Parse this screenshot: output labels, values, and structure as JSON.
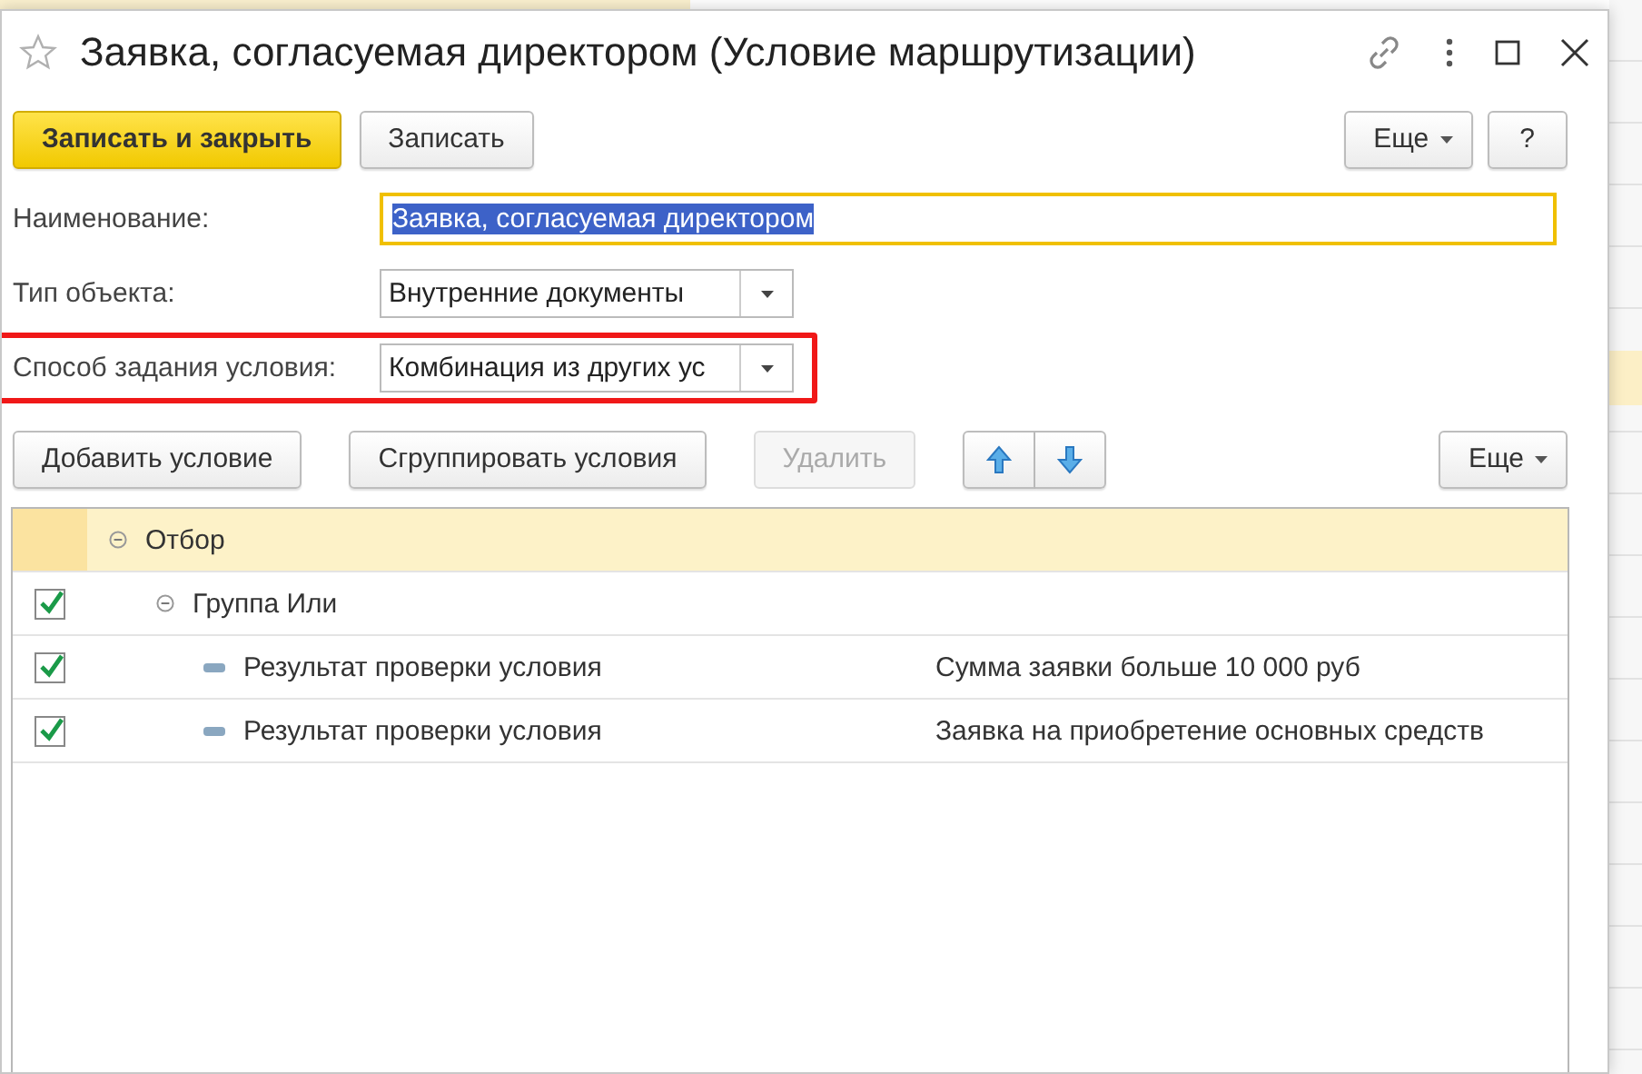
{
  "window": {
    "title": "Заявка, согласуемая директором (Условие маршрутизации)",
    "favorite": false
  },
  "toolbar": {
    "buttons": [
      {
        "label": "Записать и закрыть",
        "kind": "primary"
      },
      {
        "label": "Записать",
        "kind": "normal"
      }
    ],
    "more": "Еще",
    "help": "?"
  },
  "fields": [
    {
      "label": "Наименование:",
      "value": "Заявка, согласуемая директором",
      "kind": "text",
      "focused": true,
      "selected": true
    },
    {
      "label": "Тип объекта:",
      "value": "Внутренние документы",
      "kind": "select",
      "highlighted": false
    },
    {
      "label": "Способ задания условия:",
      "value": "Комбинация из других ус",
      "kind": "select",
      "highlighted": true
    }
  ],
  "conditions_toolbar": {
    "buttons": [
      {
        "label": "Добавить условие",
        "disabled": false
      },
      {
        "label": "Сгруппировать условия",
        "disabled": false
      },
      {
        "label": "Удалить",
        "disabled": true
      }
    ],
    "more": "Еще"
  },
  "tree": [
    {
      "label": "Отбор",
      "expanded": true,
      "selected": true,
      "children": [
        {
          "label": "Группа Или",
          "checked": true,
          "expanded": true,
          "selected": false,
          "children": [
            {
              "label": "Результат проверки условия",
              "value": "Сумма заявки больше 10 000 руб",
              "checked": true,
              "selected": false
            },
            {
              "label": "Результат проверки условия",
              "value": "Заявка на приобретение основных средств",
              "checked": true,
              "selected": false
            }
          ]
        }
      ]
    }
  ]
}
